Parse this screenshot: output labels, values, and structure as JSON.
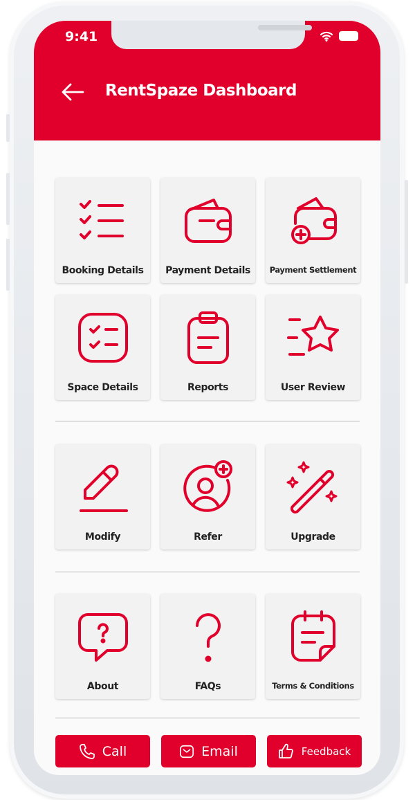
{
  "status_bar": {
    "time": "9:41"
  },
  "header": {
    "title": "RentSpaze Dashboard"
  },
  "sections": [
    {
      "tiles": [
        {
          "label": "Booking Details",
          "icon": "checklist-icon"
        },
        {
          "label": "Payment Details",
          "icon": "wallet-icon"
        },
        {
          "label": "Payment Settlement",
          "icon": "wallet-add-icon"
        },
        {
          "label": "Space Details",
          "icon": "task-square-icon"
        },
        {
          "label": "Reports",
          "icon": "clipboard-icon"
        },
        {
          "label": "User Review",
          "icon": "star-icon"
        }
      ]
    },
    {
      "tiles": [
        {
          "label": "Modify",
          "icon": "pencil-icon"
        },
        {
          "label": "Refer",
          "icon": "user-add-icon"
        },
        {
          "label": "Upgrade",
          "icon": "magic-wand-icon"
        }
      ]
    },
    {
      "tiles": [
        {
          "label": "About",
          "icon": "question-bubble-icon"
        },
        {
          "label": "FAQs",
          "icon": "question-mark-icon"
        },
        {
          "label": "Terms & Conditions",
          "icon": "note-icon"
        }
      ]
    }
  ],
  "actions": {
    "call": "Call",
    "email": "Email",
    "feedback": "Feedback"
  },
  "colors": {
    "accent": "#e0002b"
  }
}
